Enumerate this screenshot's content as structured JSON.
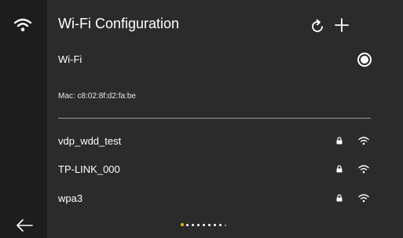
{
  "header": {
    "title": "Wi-Fi Configuration"
  },
  "wifi": {
    "label": "Wi-Fi",
    "enabled": true
  },
  "device": {
    "mac_text": "Mac: c8:02:8f:d2:fa:be"
  },
  "networks": [
    {
      "ssid": "vdp_wdd_test",
      "secured": true
    },
    {
      "ssid": "TP-LINK_000",
      "secured": true
    },
    {
      "ssid": "wpa3",
      "secured": true
    }
  ],
  "pager": {
    "total": 9,
    "active_index": 0
  },
  "colors": {
    "background": "#2b2b2b",
    "rail": "#1d1d1d",
    "accent": "#f0b400"
  },
  "icons": {
    "rail_top": "wifi-icon",
    "rail_bottom": "back-arrow-icon",
    "refresh": "refresh-icon",
    "add": "plus-icon",
    "lock": "lock-icon",
    "signal": "wifi-signal-icon"
  }
}
